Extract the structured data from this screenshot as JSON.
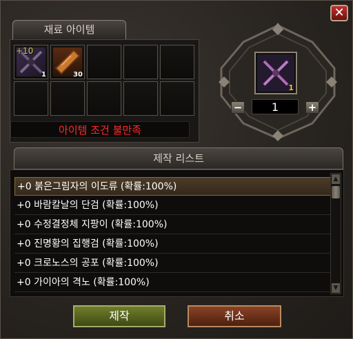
{
  "window": {
    "close_label": "✕"
  },
  "materials": {
    "tab_label": "재료 아이템",
    "slots": [
      {
        "name": "dagger",
        "enhance": "+10",
        "qty": "1"
      },
      {
        "name": "plate",
        "qty": "30"
      }
    ],
    "condition_text": "아이템 조건 불만족"
  },
  "result": {
    "qty": "1",
    "count": "1",
    "minus_label": "−",
    "plus_label": "+"
  },
  "list": {
    "header": "제작 리스트",
    "rows": [
      "+0 붉은그림자의 이도류 (확률:100%)",
      "+0 바람칼날의 단검 (확률:100%)",
      "+0 수정결정체 지팡이 (확률:100%)",
      "+0 진명황의 집행검 (확률:100%)",
      "+0 크로노스의 공포 (확률:100%)",
      "+0 가이아의 격노 (확률:100%)"
    ],
    "selected_index": 0
  },
  "buttons": {
    "make": "제작",
    "cancel": "취소"
  }
}
